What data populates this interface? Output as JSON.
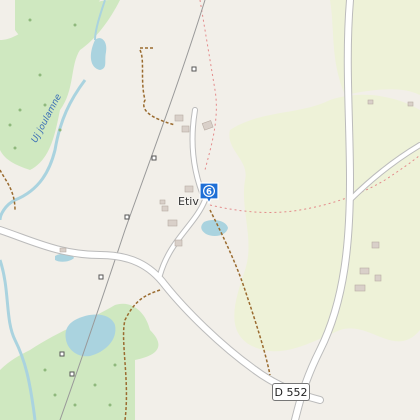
{
  "map": {
    "place_label": "Etiv",
    "river_label": "Uj joulamne",
    "road_label": "D 552",
    "marker_number": "6",
    "colors": {
      "background": "#f2efe9",
      "forest": "#cfe8c0",
      "meadow": "#eef2d8",
      "water": "#aad3df",
      "road": "#ffffff",
      "road_casing": "#bbbbbb",
      "track": "#9a6b2f",
      "boundary": "#e38a8a",
      "rail": "#999999",
      "marker": "#1f6fd6"
    }
  }
}
